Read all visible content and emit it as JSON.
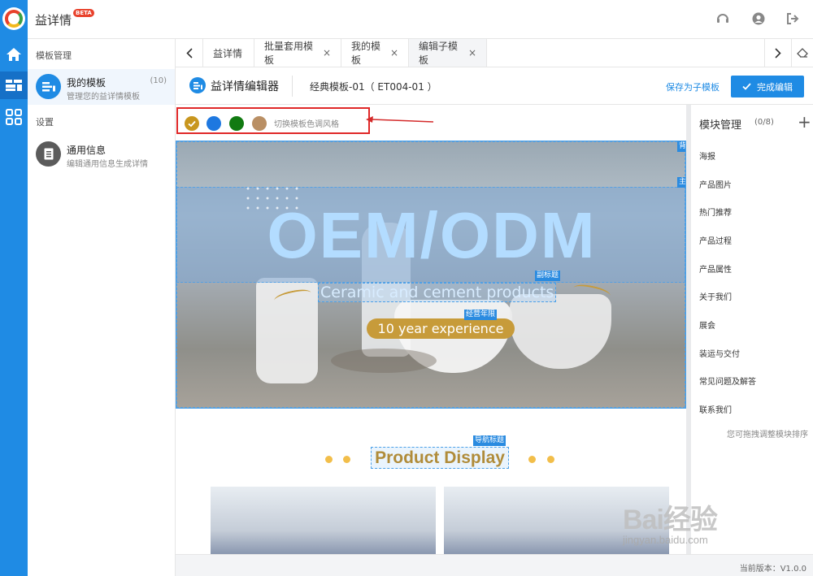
{
  "app": {
    "title": "益详情",
    "beta": "BETA"
  },
  "sidebar": {
    "section_templates": "模板管理",
    "my_templates": {
      "name": "我的模板",
      "desc": "管理您的益详情模板",
      "count": "(10)"
    },
    "section_settings": "设置",
    "general_info": {
      "name": "通用信息",
      "desc": "编辑通用信息生成详情"
    }
  },
  "tabs": [
    {
      "label": "益详情",
      "closable": false
    },
    {
      "label": "批量套用模板",
      "closable": true
    },
    {
      "label": "我的模板",
      "closable": true
    },
    {
      "label": "编辑子模板",
      "closable": true
    }
  ],
  "tab_close": "×",
  "toolbar": {
    "editor_name": "益详情编辑器",
    "template_name": "经典模板-01（ ET004-01 ）",
    "save_as_sub": "保存为子模板",
    "done": "完成编辑"
  },
  "color_switch": {
    "label": "切换模板色调风格",
    "swatches": [
      "#c8961e",
      "#1e78e0",
      "#117a11",
      "#b98f64"
    ],
    "selected_index": 0
  },
  "banner": {
    "title": "OEM/ODM",
    "subtitle": "Ceramic and cement products",
    "experience": "10 year experience",
    "tag_subtitle": "副标题",
    "tag_experience": "经营年限",
    "tag_bg": "背",
    "tag_main": "主"
  },
  "product_section": {
    "tag": "导航标题",
    "title": "Product Display"
  },
  "modules": {
    "header": "模块管理",
    "count": "(0/8)",
    "items": [
      "海报",
      "产品图片",
      "热门推荐",
      "产品过程",
      "产品属性",
      "关于我们",
      "展会",
      "装运与交付",
      "常见问题及解答",
      "联系我们"
    ],
    "hint": "您可拖拽调整模块排序"
  },
  "footer": {
    "version": "当前版本：V1.0.0"
  },
  "watermark": {
    "text": "Bai经验",
    "url": "jingyan.baidu.com"
  }
}
